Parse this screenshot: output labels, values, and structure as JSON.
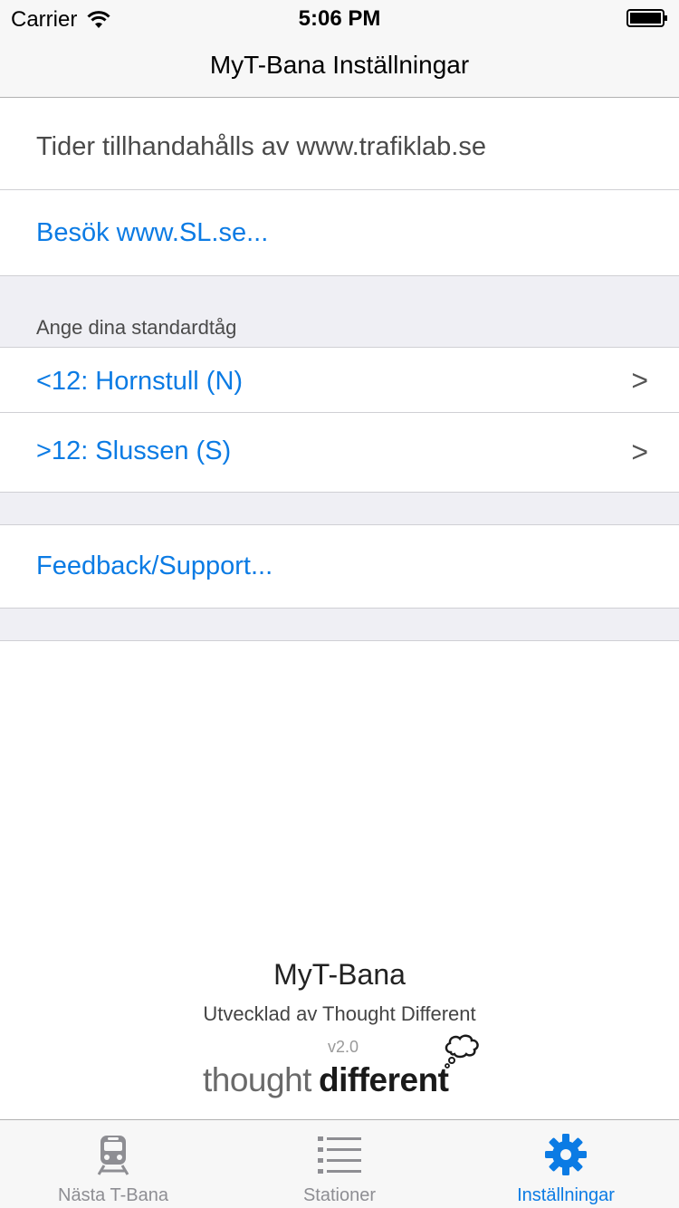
{
  "status_bar": {
    "carrier": "Carrier",
    "time": "5:06 PM"
  },
  "nav": {
    "title": "MyT-Bana Inställningar"
  },
  "rows": {
    "info": "Tider tillhandahålls av www.trafiklab.se",
    "visit_link": "Besök www.SL.se...",
    "section_header": "Ange dina standardtåg",
    "train_before_12": "<12: Hornstull (N)",
    "train_after_12": ">12: Slussen (S)",
    "chevron": ">",
    "feedback_link": "Feedback/Support..."
  },
  "footer": {
    "app_name": "MyT-Bana",
    "developed_by": "Utvecklad av Thought Different",
    "version": "v2.0",
    "logo_word1": "thought",
    "logo_word2": "different"
  },
  "tabs": [
    {
      "label": "Nästa T-Bana",
      "icon": "train-icon",
      "active": false
    },
    {
      "label": "Stationer",
      "icon": "list-icon",
      "active": false
    },
    {
      "label": "Inställningar",
      "icon": "gear-icon",
      "active": true
    }
  ],
  "colors": {
    "accent": "#0b7be4",
    "inactive": "#8e8e93",
    "background": "#efeff4"
  }
}
